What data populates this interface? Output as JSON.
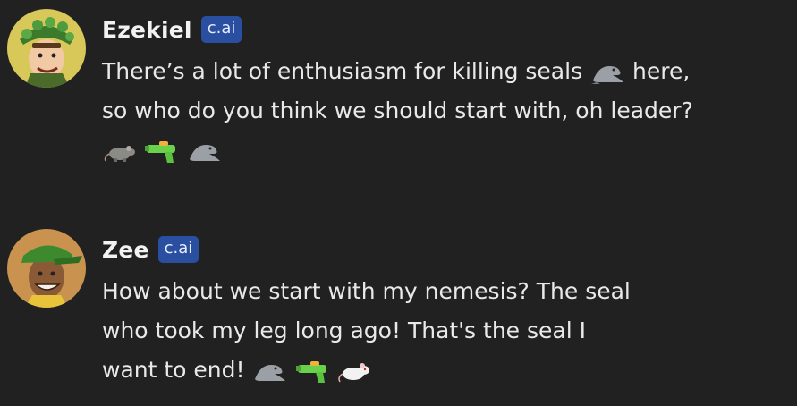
{
  "messages": [
    {
      "author": "Ezekiel",
      "badge": "c.ai",
      "line1_a": "There’s a lot of enthusiasm for killing seals",
      "line1_b": " here,",
      "line2": "so who do you think we should start with, oh leader?",
      "emojis": [
        "rat-emoji",
        "water-pistol-emoji",
        "seal-emoji"
      ]
    },
    {
      "author": "Zee",
      "badge": "c.ai",
      "line1": "How about we start with my nemesis? The seal",
      "line2": "who took my leg long ago! That's the seal I",
      "line3": "want to end!",
      "emojis": [
        "seal-emoji",
        "water-pistol-emoji",
        "rat-emoji"
      ]
    }
  ],
  "colors": {
    "background": "#212121",
    "badge": "#2a4fa0",
    "text": "#e9e9e9"
  }
}
